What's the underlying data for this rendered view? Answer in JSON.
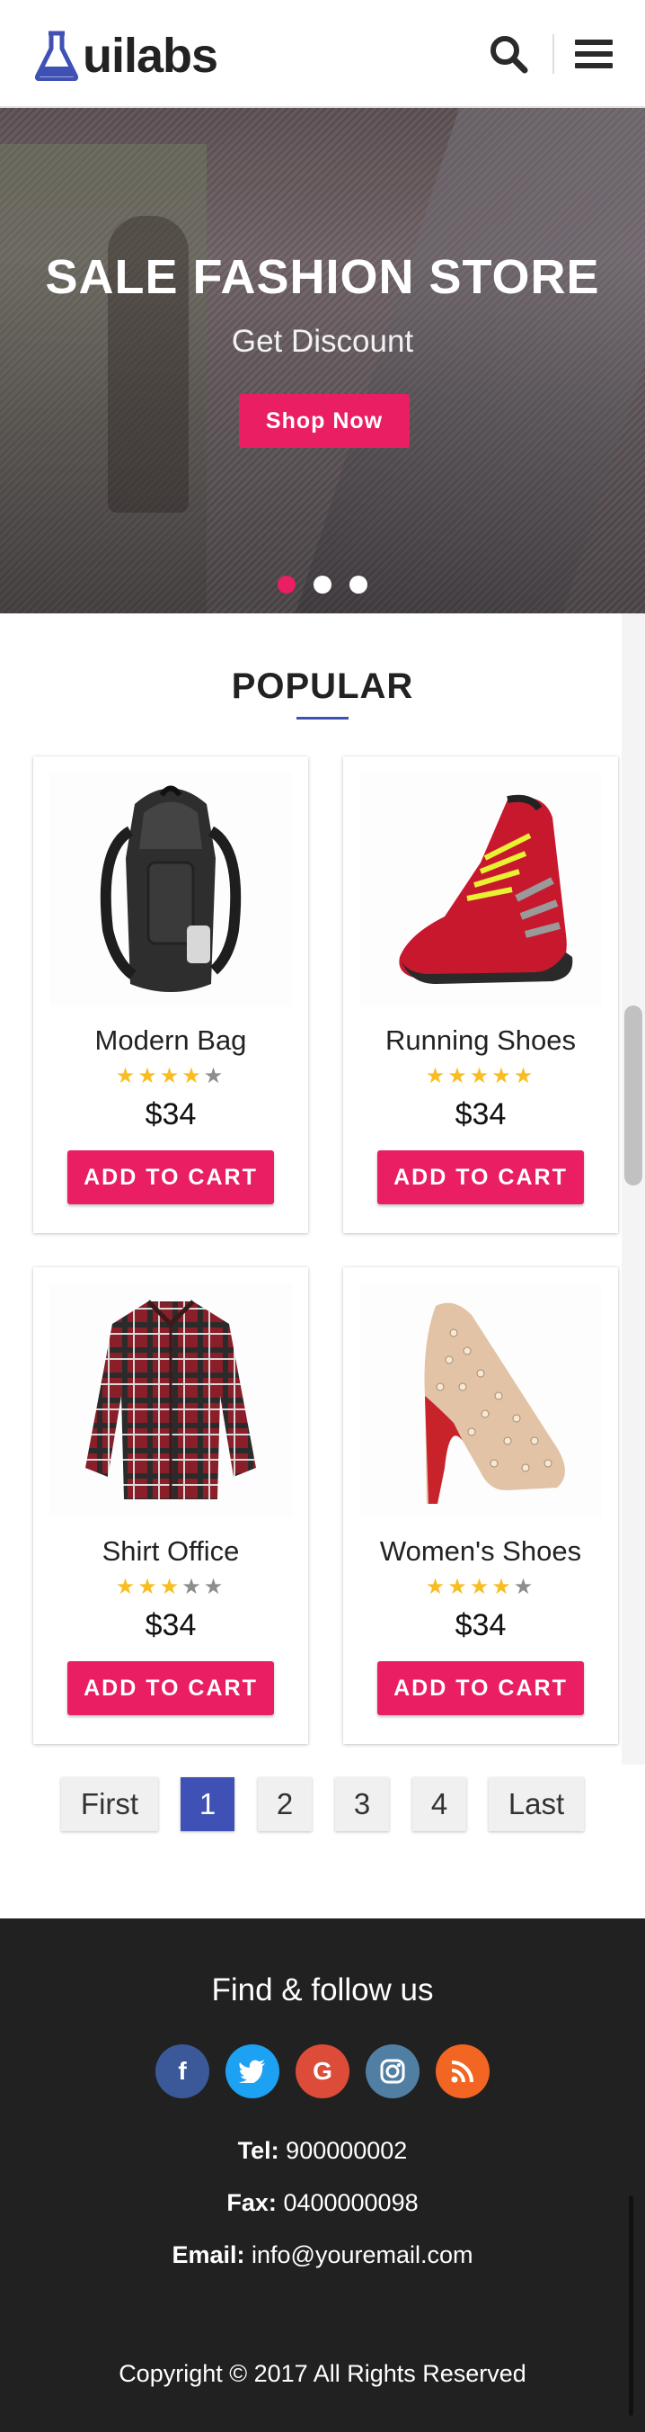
{
  "header": {
    "logo_text": "uilabs",
    "icons": [
      "flask-icon",
      "search-icon",
      "menu-icon"
    ]
  },
  "hero": {
    "title": "SALE FASHION STORE",
    "subtitle": "Get Discount",
    "button_label": "Shop Now",
    "slides_count": 3,
    "active_slide": 1
  },
  "popular": {
    "title": "POPULAR",
    "products": [
      {
        "name": "Modern Bag",
        "rating": 4,
        "rating_max": 5,
        "price": "$34",
        "button_label": "ADD TO CART",
        "image": "backpack-icon"
      },
      {
        "name": "Running Shoes",
        "rating": 5,
        "rating_max": 5,
        "price": "$34",
        "button_label": "ADD TO CART",
        "image": "sneaker-icon"
      },
      {
        "name": "Shirt Office",
        "rating": 3,
        "rating_max": 5,
        "price": "$34",
        "button_label": "ADD TO CART",
        "image": "shirt-icon"
      },
      {
        "name": "Women's Shoes",
        "rating": 4,
        "rating_max": 5,
        "price": "$34",
        "button_label": "ADD TO CART",
        "image": "high-heel-icon"
      }
    ]
  },
  "pagination": {
    "first": "First",
    "pages": [
      "1",
      "2",
      "3",
      "4"
    ],
    "active_page": "1",
    "last": "Last"
  },
  "footer": {
    "title": "Find & follow us",
    "socials": [
      {
        "name": "facebook",
        "glyph": "f",
        "color": "#3b5998"
      },
      {
        "name": "twitter",
        "glyph": "t",
        "color": "#1da1f2"
      },
      {
        "name": "google",
        "glyph": "G",
        "color": "#dd4b39"
      },
      {
        "name": "instagram",
        "glyph": "ig",
        "color": "#517fa4"
      },
      {
        "name": "rss",
        "glyph": "rss",
        "color": "#f26522"
      }
    ],
    "tel_label": "Tel:",
    "tel_value": "900000002",
    "fax_label": "Fax:",
    "fax_value": "0400000098",
    "email_label": "Email:",
    "email_value": "info@youremail.com",
    "copyright": "Copyright © 2017 All Rights Reserved"
  },
  "colors": {
    "accent": "#e91e63",
    "primary": "#3f51b5",
    "star_on": "#f7bd23",
    "star_off": "#8d8d8d",
    "footer_bg": "#212121"
  }
}
